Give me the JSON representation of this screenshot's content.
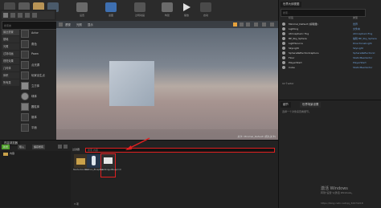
{
  "toolbar": {
    "buttons": [
      {
        "label": "保存",
        "icon": "save-icon"
      },
      {
        "label": "源码管理",
        "icon": "source-control-icon"
      },
      {
        "label": "内容",
        "icon": "content-icon"
      },
      {
        "label": "市场",
        "icon": "marketplace-icon"
      },
      {
        "label": "设置",
        "icon": "settings-icon"
      },
      {
        "label": "蓝图",
        "icon": "blueprint-icon"
      },
      {
        "label": "过场动画",
        "icon": "cinematics-icon"
      },
      {
        "label": "构建",
        "icon": "build-icon"
      },
      {
        "label": "播放",
        "icon": "play-icon"
      },
      {
        "label": "启动",
        "icon": "launch-icon"
      }
    ]
  },
  "modes": {
    "search_placeholder": "搜索类",
    "categories": [
      "最近放置",
      "基础",
      "光照",
      "过场动画",
      "视觉效果",
      "几何体",
      "体积",
      "所有类"
    ],
    "items": [
      "Actor",
      "角色",
      "Pawn",
      "点光源",
      "玩家出生点",
      "立方体",
      "球体",
      "圆柱体",
      "锥体",
      "平面"
    ]
  },
  "viewport": {
    "toolbar": [
      "透视",
      "光照",
      "显示"
    ],
    "level_label": "关卡: Minimal_Default (持久关卡)"
  },
  "outliner": {
    "tab": "世界大纲视图",
    "search_placeholder": "搜索...",
    "col_label": "标签",
    "col_type": "类型",
    "rows": [
      {
        "name": "Minimal_Default (编辑器)",
        "type": "世界"
      },
      {
        "name": "Lighting",
        "type": "文件夹"
      },
      {
        "name": "Atmospheric Fog",
        "type": "AtmosphericFog"
      },
      {
        "name": "BP_Sky_Sphere",
        "type": "编辑 BP_Sky_Sphere"
      },
      {
        "name": "LightSource",
        "type": "DirectionalLight"
      },
      {
        "name": "SkyLight",
        "type": "SkyLight"
      },
      {
        "name": "SphereReflectionCapture",
        "type": "SphereReflectionC"
      },
      {
        "name": "Floor",
        "type": "StaticMeshActor"
      },
      {
        "name": "PlayerStart",
        "type": "PlayerStart"
      },
      {
        "name": "Cube",
        "type": "StaticMeshActor"
      }
    ],
    "status": "11个actor"
  },
  "details": {
    "tabs": [
      "细节",
      "世界场景设置"
    ],
    "hint": "选择一个对象来查看细节。"
  },
  "content_browser": {
    "tab": "内容浏览器",
    "add_label": "新增",
    "import_label": "导入",
    "save_all_label": "保存所有",
    "filter_label": "过滤器",
    "search_placeholder": "搜索 内容",
    "path": "内容",
    "assets": [
      {
        "name": "StarterContent",
        "kind": "folder"
      },
      {
        "name": "Human_Blueprint",
        "kind": "blueprint"
      },
      {
        "name": "NewWidgetBlueprint",
        "kind": "widget"
      }
    ],
    "status": "3 项"
  },
  "watermark": {
    "line1": "激活 Windows",
    "line2": "转到\"设置\"以激活 Windows。",
    "url": "https://blog.csdn.net/qq_32074218"
  },
  "colors": {
    "accent_green": "#4fa02a",
    "highlight_red": "#e02020",
    "link_blue": "#6fa0d8"
  }
}
